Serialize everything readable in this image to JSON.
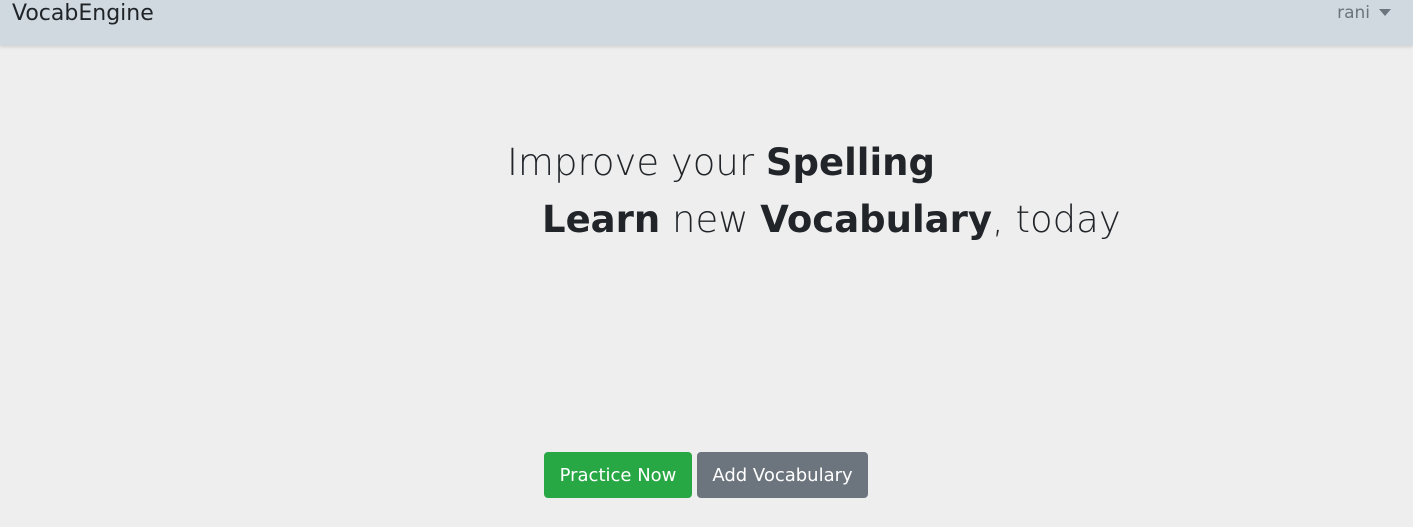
{
  "navbar": {
    "brand": "VocabEngine",
    "user": "rani",
    "user_menu_icon": "caret-down-icon"
  },
  "hero": {
    "line1": {
      "prefix": "Improve your ",
      "emphasis": "Spelling"
    },
    "line2": {
      "word1": "Learn",
      "middle": " new ",
      "word2": "Vocabulary",
      "suffix": ", today"
    }
  },
  "actions": {
    "practice_label": "Practice Now",
    "add_label": "Add Vocabulary"
  },
  "colors": {
    "navbar": "#d0d9df",
    "background": "#eeeeee",
    "practice": "#28a745",
    "secondary": "#6c757d"
  }
}
